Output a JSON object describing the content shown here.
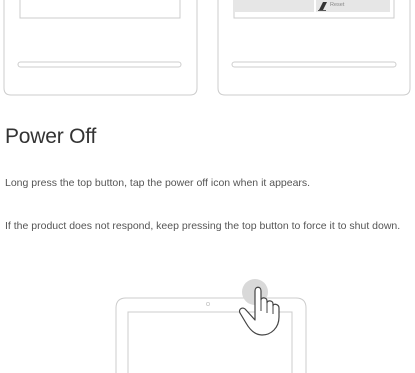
{
  "illustration_top": {
    "reset_label": "Reset"
  },
  "section": {
    "title": "Power Off",
    "paragraphs": [
      "Long press the top button, tap the power off icon when it appears.",
      "If the product does not respond, keep pressing the top button to force it to shut down."
    ]
  },
  "colors": {
    "outline": "#cccccc",
    "button_panel": "#e6e6e6",
    "press_highlight": "#d9d9d9",
    "hand_fill": "#ffffff",
    "hand_stroke": "#444444"
  },
  "icons": {
    "reset_icon": "eraser-icon",
    "hand_icon": "pointing-hand-icon",
    "press_indicator": "press-circle-icon"
  }
}
